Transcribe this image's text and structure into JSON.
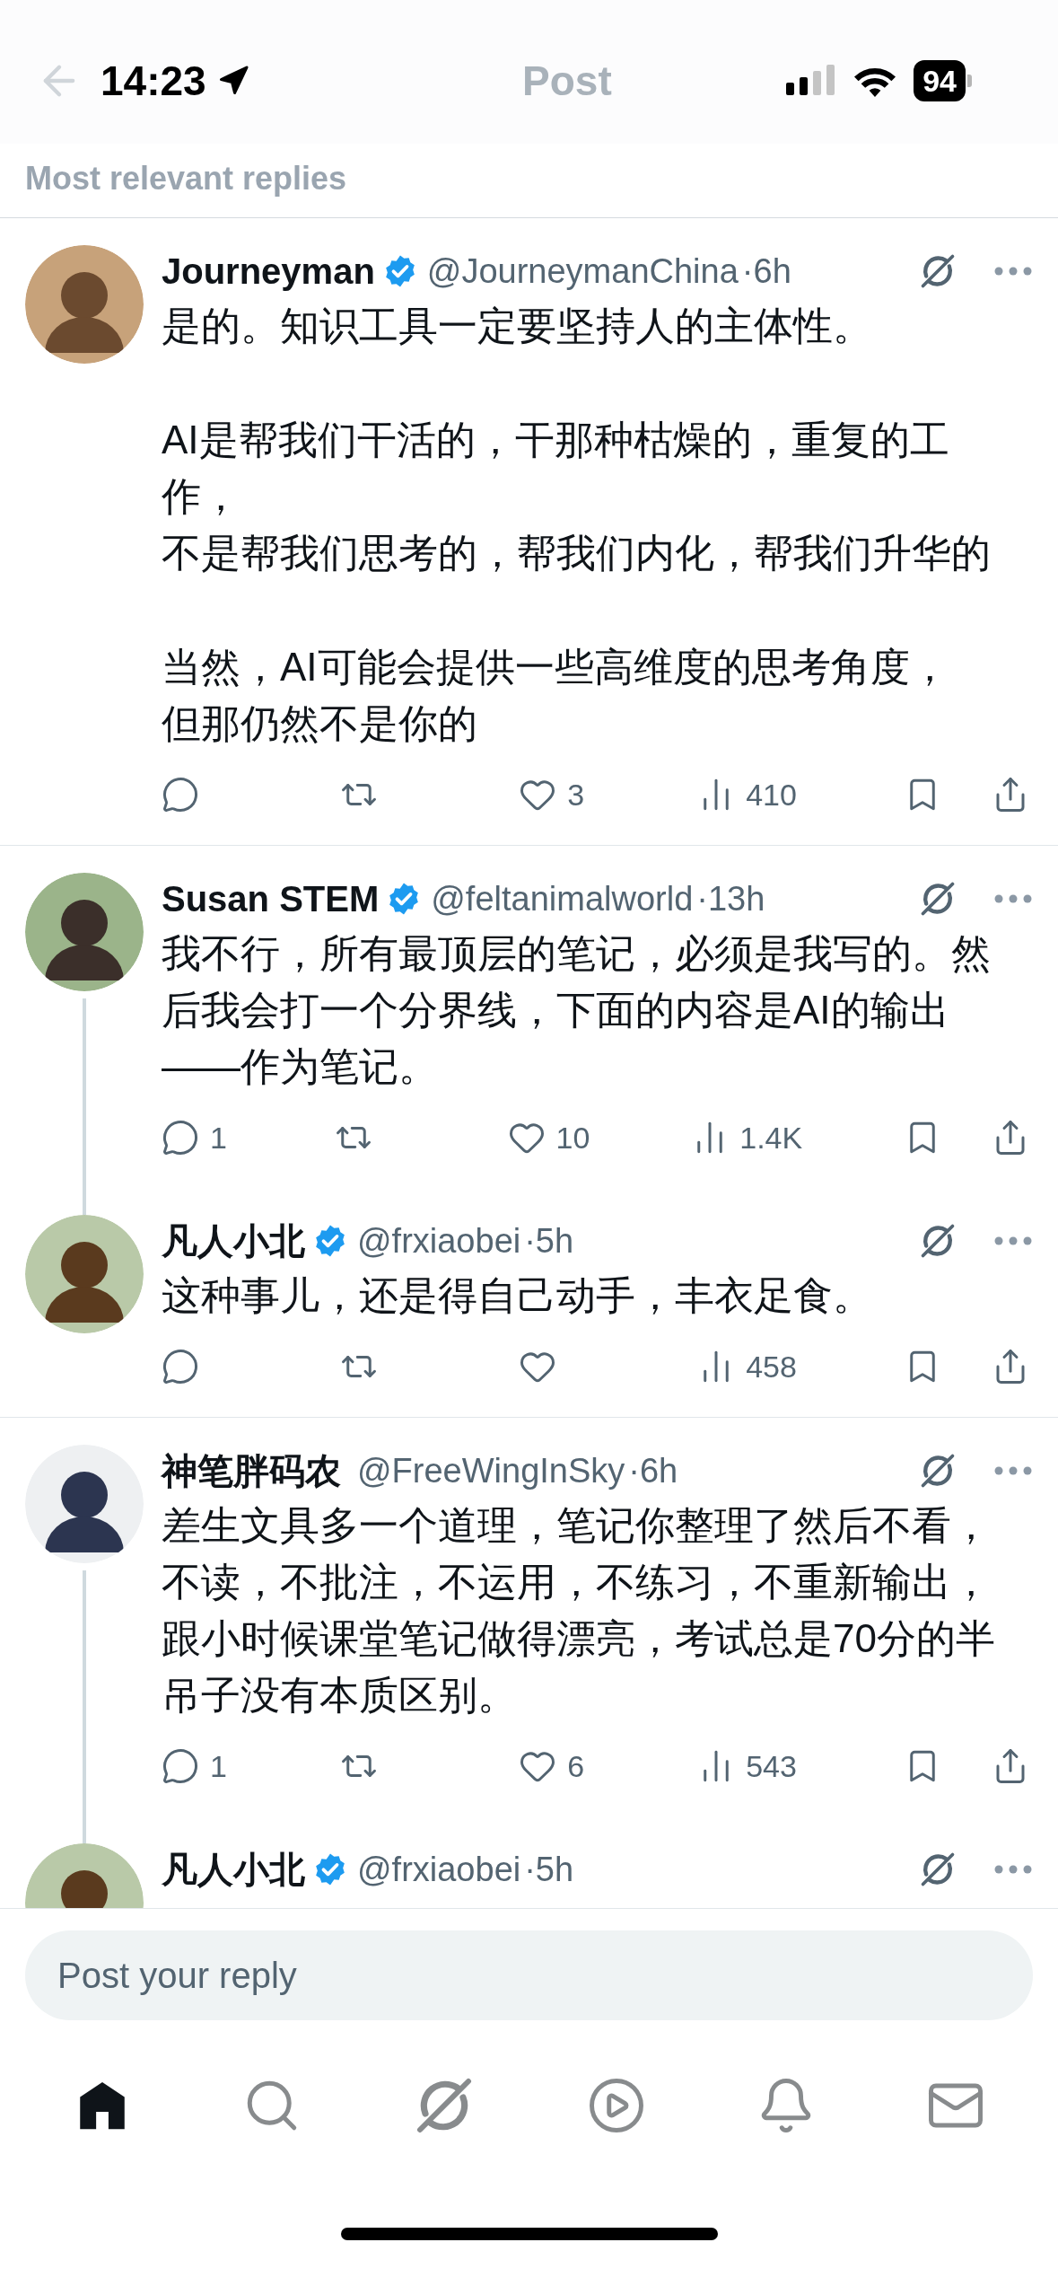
{
  "status_bar": {
    "time": "14:23",
    "battery": "94"
  },
  "header": {
    "title": "Post"
  },
  "sort_label": "Most relevant replies",
  "replies": [
    {
      "name": "Journeyman",
      "handle": "@JourneymanChina",
      "time": "·6h",
      "verified": true,
      "thread_next": false,
      "paragraphs": [
        [
          "是的。知识工具一定要坚持人的主体性。"
        ],
        [
          "AI是帮我们干活的，干那种枯燥的，重复的工作，",
          "不是帮我们思考的，帮我们内化，帮我们升华的"
        ],
        [
          "当然，AI可能会提供一些高维度的思考角度，",
          "但那仍然不是你的"
        ]
      ],
      "actions": {
        "like": "3",
        "views": "410"
      }
    },
    {
      "name": "Susan STEM",
      "handle": "@feltanimalworld",
      "time": "·13h",
      "verified": true,
      "thread_next": true,
      "paragraphs": [
        [
          "我不行，所有最顶层的笔记，必须是我写的。然后我会打一个分界线，下面的内容是AI的输出——作为笔记。"
        ]
      ],
      "actions": {
        "reply": "1",
        "like": "10",
        "views": "1.4K"
      }
    },
    {
      "name": "凡人小北",
      "handle": "@frxiaobei",
      "time": "·5h",
      "verified": true,
      "thread_next": false,
      "paragraphs": [
        [
          "这种事儿，还是得自己动手，丰衣足食。"
        ]
      ],
      "actions": {
        "views": "458"
      }
    },
    {
      "name": "神笔胖码农",
      "handle": "@FreeWingInSky",
      "time": "·6h",
      "verified": false,
      "thread_next": true,
      "paragraphs": [
        [
          "差生文具多一个道理，笔记你整理了然后不看，不读，不批注，不运用，不练习，不重新输出，跟小时候课堂笔记做得漂亮，考试总是70分的半吊子没有本质区别。"
        ]
      ],
      "actions": {
        "reply": "1",
        "like": "6",
        "views": "543"
      }
    },
    {
      "name": "凡人小北",
      "handle": "@frxiaobei",
      "time": "·5h",
      "verified": true,
      "thread_next": false
    }
  ],
  "composer": {
    "placeholder": "Post your reply"
  },
  "tab_bar": [
    {
      "kind": "home",
      "selected": true
    },
    {
      "kind": "search",
      "selected": false
    },
    {
      "kind": "grok",
      "selected": false
    },
    {
      "kind": "video",
      "selected": false
    },
    {
      "kind": "notifications",
      "selected": false
    },
    {
      "kind": "messages",
      "selected": false
    }
  ]
}
